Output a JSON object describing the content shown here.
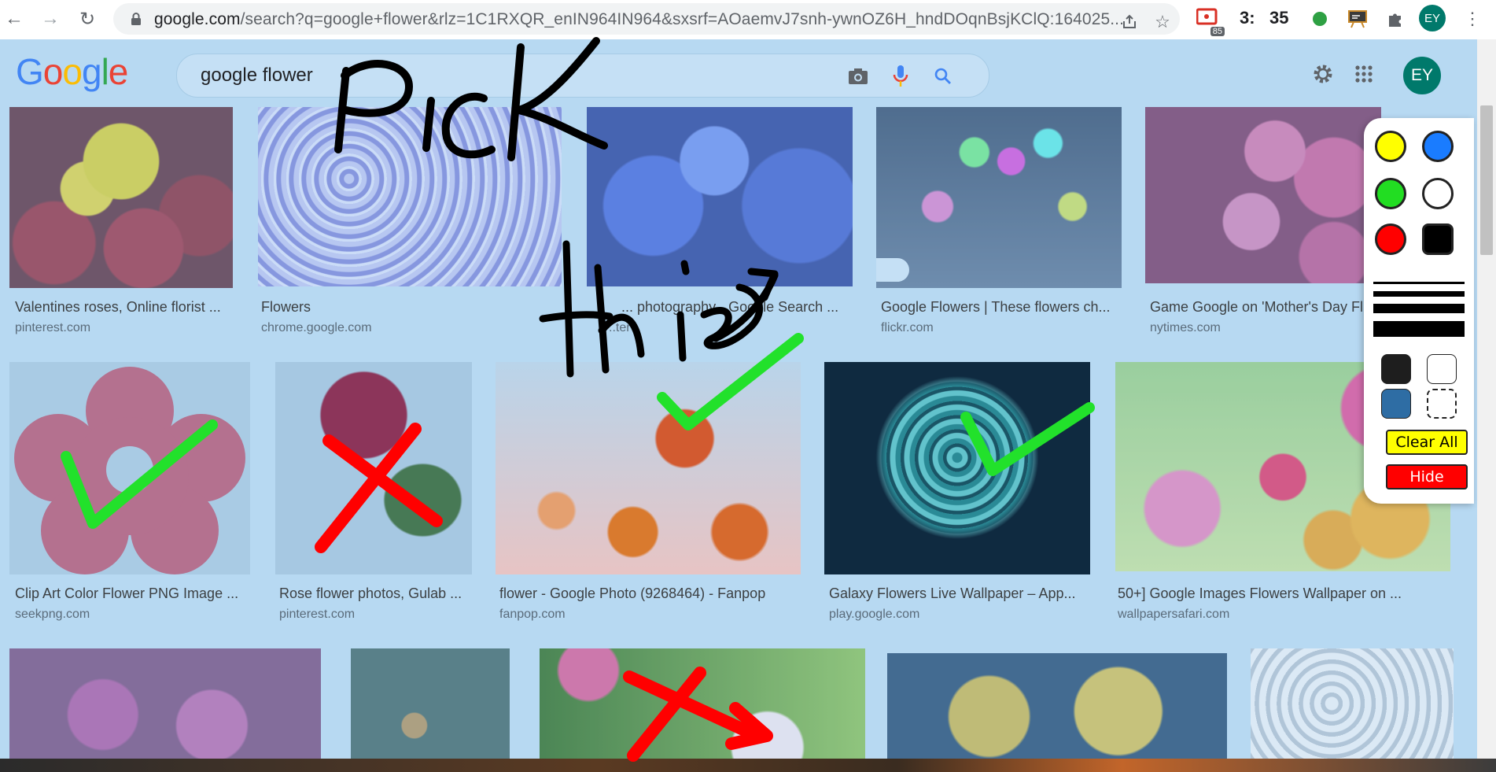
{
  "browser": {
    "url_host": "google.com",
    "url_rest": "/search?q=google+flower&rlz=1C1RXQR_enIN964IN964&sxsrf=AOaemvJ7snh-ywnOZ6H_hndDOqnBsjKClQ:164025...",
    "extension_badge": "85",
    "clock_hours": "3:",
    "clock_minutes": "35",
    "profile_initials": "EY",
    "icons": [
      "back-icon",
      "forward-icon",
      "reload-icon",
      "lock-icon",
      "share-icon",
      "star-icon",
      "screen-recorder-icon",
      "green-dot-icon",
      "whiteboard-icon",
      "puzzle-icon",
      "more-icon"
    ]
  },
  "google": {
    "logo_letters": [
      "G",
      "o",
      "o",
      "g",
      "l",
      "e"
    ],
    "logo_colors": [
      "#4285f4",
      "#ea4335",
      "#fbbc05",
      "#4285f4",
      "#34a853",
      "#ea4335"
    ],
    "search_query": "google flower",
    "profile_initials": "EY",
    "icons": [
      "camera-icon",
      "mic-icon",
      "search-icon",
      "settings-icon",
      "apps-icon"
    ]
  },
  "results": {
    "row1": [
      {
        "caption": "Valentines roses, Online florist ...",
        "source": "pinterest.com"
      },
      {
        "caption": "Flowers",
        "source": "chrome.google.com"
      },
      {
        "caption": "... photography - Google Search ...",
        "source": "..ter"
      },
      {
        "caption": "Google Flowers | These flowers ch...",
        "source": "flickr.com"
      },
      {
        "caption": "Game Google on 'Mother's Day Fl",
        "source": "nytimes.com"
      }
    ],
    "row2": [
      {
        "caption": "Clip Art Color Flower PNG Image ...",
        "source": "seekpng.com"
      },
      {
        "caption": "Rose flower photos, Gulab ...",
        "source": "pinterest.com"
      },
      {
        "caption": "flower - Google Photo (9268464) - Fanpop",
        "source": "fanpop.com"
      },
      {
        "caption": "Galaxy Flowers Live Wallpaper – App...",
        "source": "play.google.com"
      },
      {
        "caption": "50+] Google Images Flowers Wallpaper on ...",
        "source": "wallpapersafari.com"
      }
    ]
  },
  "annotation_panel": {
    "pen_colors": [
      "#ffff00",
      "#1a7cff",
      "#22dd22",
      "#ffffff",
      "#ff0000",
      "#000000"
    ],
    "bg_options": [
      "#1e1e1e",
      "#ffffff",
      "#2e6da4",
      "transparent"
    ],
    "clear_label": "Clear All",
    "hide_label": "Hide",
    "clear_color": "#ffff00",
    "hide_color": "#ff0000"
  },
  "handwriting": {
    "word1": "Pick",
    "word2": "this"
  }
}
